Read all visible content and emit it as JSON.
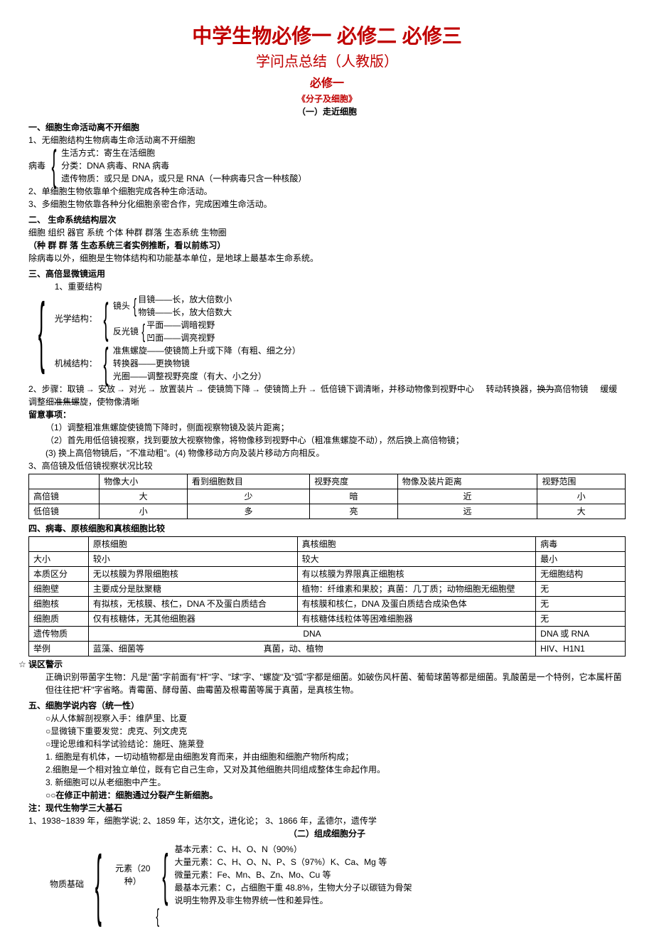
{
  "header": {
    "main": "中学生物必修一 必修二 必修三",
    "sub": "学问点总结（人教版）",
    "sec": "必修一",
    "book": "《分子及细胞》",
    "part": "（一）走近细胞"
  },
  "s1": {
    "h": "一、细胞生命活动离不开细胞",
    "p1": "1、无细胞结构生物病毒生命活动离不开细胞",
    "virus_label": "病毒",
    "v1": "生活方式：寄生在活细胞",
    "v2": "分类：DNA 病毒、RNA 病毒",
    "v3": "遗传物质：或只是 DNA，或只是 RNA（一种病毒只含一种核酸）",
    "p2": "2、单细胞生物依靠单个细胞完成各种生命活动。",
    "p3": "3、多细胞生物依靠各种分化细胞亲密合作，完成困难生命活动。"
  },
  "s2": {
    "h": "二、 生命系统结构层次",
    "p1": "细胞   组织   器官   系统   个体   种群   群落   生态系统    生物圈",
    "p2": "（种 群   群 落   生态系统三者实例推断，看以前练习）",
    "p3": "除病毒以外，细胞是生物体结构和功能基本单位，是地球上最基本生命系统。"
  },
  "s3": {
    "h": "三、高倍显微镜运用",
    "p1": "1、重要结构",
    "opt_label": "光学结构：",
    "lens_label": "镜头",
    "lens1": "目镜——长，放大倍数小",
    "lens2": "物镜——长，放大倍数大",
    "mirror_label": "反光镜",
    "mirror1": "平面——调暗视野",
    "mirror2": "凹面——调亮视野",
    "mech_label": "机械结构：",
    "mech1": "准焦螺旋——使镜筒上升或下降（有粗、细之分）",
    "mech2": "转换器——更换物镜",
    "mech3": "光圈——调整视野亮度（有大、小之分）",
    "step_label": "2、步骤：取镜",
    "step1": "安放",
    "step2": "对光",
    "step3": "放置装片",
    "step4": "使镜筒下降",
    "step5": "使镜筒上升",
    "step6": "低倍镜下调清晰，并移动物像到视野中心",
    "step7": "转动转换器，",
    "step7a": "换为",
    "step7b": "高倍物镜",
    "step8": "缓缓调整细",
    "step8a": "准焦螺",
    "step8b": "旋，使物像清晰",
    "notes_h": "留意事项：",
    "n1": "（1）调整粗准焦螺旋使镜筒下降时，侧面视察物镜及装片距离；",
    "n2": "（2）首先用低倍镜视察，找到要放大视察物像，将物像移到视野中心（粗准焦螺旋不动），然后换上高倍物镜；",
    "n3": "(3) 换上高倍物镜后，\"不准动粗\"。(4) 物像移动方向及装片移动方向相反。",
    "p3": "3、高倍镜及低倍镜视察状况比较"
  },
  "t1": {
    "h": [
      "",
      "物像大小",
      "看到细胞数目",
      "视野亮度",
      "物像及装片距离",
      "视野范围"
    ],
    "r1": [
      "高倍镜",
      "大",
      "少",
      "暗",
      "近",
      "小"
    ],
    "r2": [
      "低倍镜",
      "小",
      "多",
      "亮",
      "远",
      "大"
    ]
  },
  "s4": {
    "h": "四、病毒、原核细胞和真核细胞比较"
  },
  "t2": {
    "h": [
      "",
      "原核细胞",
      "真核细胞",
      "病毒"
    ],
    "r1": [
      "大小",
      "较小",
      "较大",
      "最小"
    ],
    "r2": [
      "本质区分",
      "无以核膜为界限细胞核",
      "有以核膜为界限真正细胞核",
      "无细胞结构"
    ],
    "r3": [
      "细胞壁",
      "主要成分是肽聚糖",
      "植物：纤维素和果胶；真菌：几丁质；动物细胞无细胞壁",
      "无"
    ],
    "r4": [
      "细胞核",
      "有拟核，无核膜、核仁，DNA 不及蛋白质结合",
      "有核膜和核仁，DNA 及蛋白质结合成染色体",
      "无"
    ],
    "r5": [
      "细胞质",
      "仅有核糖体，无其他细胞器",
      "有核糖体线粒体等困难细胞器",
      "无"
    ],
    "r6a": "遗传物质",
    "r6b": "DNA",
    "r6c": "DNA 或 RNA",
    "r7": [
      "举例",
      "蓝藻、细菌等",
      "真菌，动、植物",
      "HIV、H1N1"
    ]
  },
  "warn": {
    "h": "误区警示",
    "p": "正确识别带菌字生物：凡是\"菌\"字前面有\"杆\"字、\"球\"字、\"螺旋\"及\"弧\"字都是细菌。如破伤风杆菌、葡萄球菌等都是细菌。乳酸菌是一个特例，它本属杆菌但往往把\"杆\"字省略。青霉菌、酵母菌、曲霉菌及根霉菌等属于真菌，是真核生物。"
  },
  "s5": {
    "h": "五、细胞学说内容（统一性）",
    "p1": "○从人体解剖视察入手：维萨里、比夏",
    "p2": "○显微镜下重要发觉：虎克、列文虎克",
    "p3": "○理论思维和科学试验结论：施旺、施莱登",
    "p4": "1. 细胞是有机体，一切动植物都是由细胞发育而来，并由细胞和细胞产物所构成；",
    "p5": "2.细胞是一个相对独立单位，既有它自己生命，又对及其他细胞共同组成整体生命起作用。",
    "p6": "3. 新细胞可以从老细胞中产生。",
    "p7": "○在修正中前进：细胞通过分裂产生新细胞。",
    "note_h": "注：现代生物学三大基石",
    "note_p": "1、1938~1839 年，细胞学说; 2、1859 年，达尔文，进化论； 3、1866 年，孟德尔，遗传学"
  },
  "part2": "（二）组成细胞分子",
  "s6": {
    "mat_label": "物质基础",
    "elem_label": "元素（20 种）",
    "e1": "基本元素：C、H、O、N（90%）",
    "e2": "大量元素：C、H、O、N、P、S（97%）K、Ca、Mg 等",
    "e3": "微量元素：Fe、Mn、B、Zn、Mo、Cu 等",
    "e4": "最基本元素：C，占细胞干重 48.8%，生物大分子以碳链为骨架",
    "e5": "说明生物界及非生物界统一性和差异性。"
  }
}
